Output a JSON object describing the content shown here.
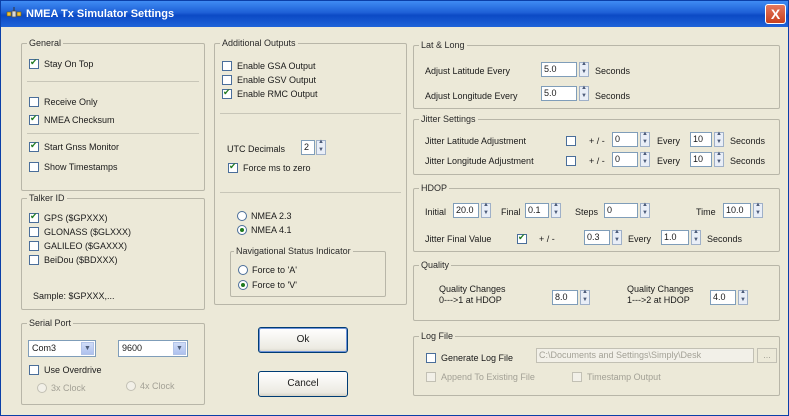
{
  "window": {
    "title": "NMEA Tx Simulator Settings",
    "close_glyph": "X"
  },
  "general": {
    "legend": "General",
    "stay_on_top": {
      "label": "Stay On Top",
      "checked": true
    },
    "receive_only": {
      "label": "Receive Only",
      "checked": false
    },
    "nmea_checksum": {
      "label": "NMEA Checksum",
      "checked": true
    },
    "start_gnss_monitor": {
      "label": "Start Gnss Monitor",
      "checked": true
    },
    "show_timestamps": {
      "label": "Show Timestamps",
      "checked": false
    }
  },
  "talker_id": {
    "legend": "Talker ID",
    "options": [
      {
        "label": "GPS ($GPXXX)",
        "checked": true
      },
      {
        "label": "GLONASS ($GLXXX)",
        "checked": false
      },
      {
        "label": "GALILEO ($GAXXX)",
        "checked": false
      },
      {
        "label": "BeiDou ($BDXXX)",
        "checked": false
      }
    ],
    "sample": "Sample:   $GPXXX,..."
  },
  "serial_port": {
    "legend": "Serial Port",
    "port": "Com3",
    "baud": "9600",
    "use_overdrive": {
      "label": "Use Overdrive",
      "checked": false
    },
    "radio1": "3x Clock",
    "radio2": "4x Clock"
  },
  "additional_outputs": {
    "legend": "Additional Outputs",
    "gsa": {
      "label": "Enable GSA Output",
      "checked": false
    },
    "gsv": {
      "label": "Enable GSV Output",
      "checked": false
    },
    "rmc": {
      "label": "Enable RMC Output",
      "checked": true
    },
    "utc_label": "UTC Decimals",
    "utc_value": "2",
    "force_ms_zero": {
      "label": "Force ms to zero",
      "checked": true
    },
    "nmea23": {
      "label": "NMEA 2.3",
      "selected": false
    },
    "nmea41": {
      "label": "NMEA 4.1",
      "selected": true
    },
    "nav_status": {
      "legend": "Navigational Status Indicator",
      "force_a": {
        "label": "Force to 'A'",
        "selected": false
      },
      "force_v": {
        "label": "Force to 'V'",
        "selected": true
      }
    }
  },
  "buttons": {
    "ok": "Ok",
    "cancel": "Cancel"
  },
  "lat_long": {
    "legend": "Lat & Long",
    "lat_label": "Adjust Latitude Every",
    "lat_value": "5.0",
    "long_label": "Adjust Longitude Every",
    "long_value": "5.0",
    "unit": "Seconds"
  },
  "jitter": {
    "legend": "Jitter Settings",
    "lat_label": "Jitter Latitude Adjustment",
    "long_label": "Jitter Longitude Adjustment",
    "pm": "+ / -",
    "lat_value": "0",
    "long_value": "0",
    "every": "Every",
    "lat_every": "10",
    "long_every": "10",
    "unit": "Seconds"
  },
  "hdop": {
    "legend": "HDOP",
    "initial_label": "Initial",
    "initial_value": "20.0",
    "final_label": "Final",
    "final_value": "0.1",
    "steps_label": "Steps",
    "steps_value": "0",
    "time_label": "Time",
    "time_value": "10.0",
    "jitter_label": "Jitter Final Value",
    "jitter_checked": true,
    "pm": "+ / -",
    "jitter_value": "0.3",
    "every": "Every",
    "every_value": "1.0",
    "unit": "Seconds"
  },
  "quality": {
    "legend": "Quality",
    "change1_l1": "Quality Changes",
    "change1_l2": "0--->1 at HDOP",
    "change1_value": "8.0",
    "change2_l1": "Quality Changes",
    "change2_l2": "1--->2 at HDOP",
    "change2_value": "4.0"
  },
  "log_file": {
    "legend": "Log File",
    "generate": {
      "label": "Generate Log File",
      "checked": false
    },
    "path": "C:\\Documents and Settings\\Simply\\Desk",
    "browse": "...",
    "append": "Append To Existing File",
    "timestamp": "Timestamp Output"
  }
}
